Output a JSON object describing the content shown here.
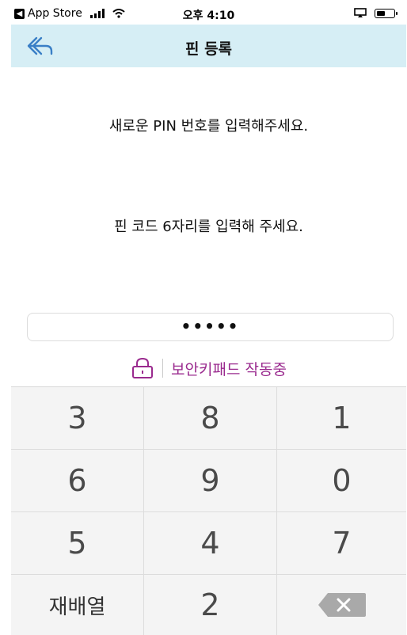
{
  "status_bar": {
    "back_app": "App Store",
    "time": "오후 4:10"
  },
  "nav": {
    "title": "핀 등록",
    "back_icon": "back-arrow-icon"
  },
  "content": {
    "message_primary": "새로운 PIN 번호를 입력해주세요.",
    "message_secondary": "핀 코드 6자리를 입력해 주세요.",
    "pin_masked": "•••••",
    "secure_label": "보안키패드 작동중"
  },
  "keypad": {
    "keys": [
      "3",
      "8",
      "1",
      "6",
      "9",
      "0",
      "5",
      "4",
      "7",
      "재배열",
      "2",
      ""
    ],
    "shuffle_label": "재배열",
    "backspace_icon": "backspace-icon"
  },
  "colors": {
    "nav_bg": "#d6eef5",
    "accent": "#9a2a8e",
    "keypad_bg": "#f4f4f4"
  }
}
